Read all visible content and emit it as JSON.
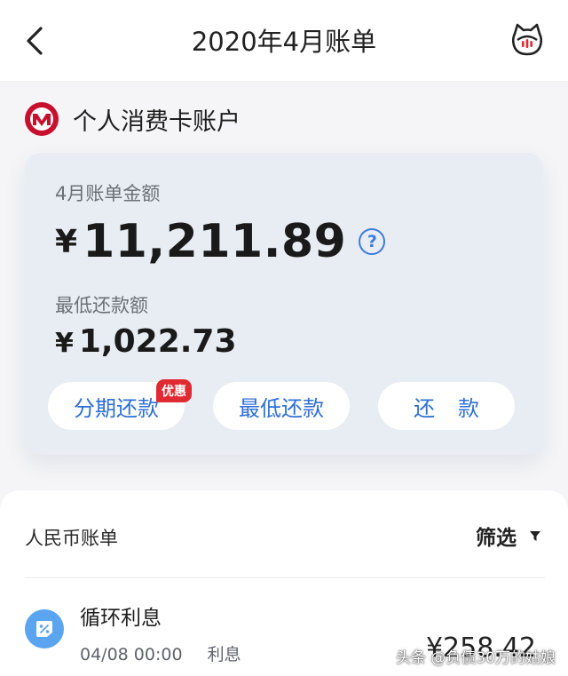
{
  "nav": {
    "title": "2020年4月账单",
    "back_icon": "chevron-left-icon",
    "mascot_icon": "cat-mascot-icon"
  },
  "account": {
    "name": "个人消费卡账户",
    "logo_icon": "bank-logo-icon",
    "brand_color": "#c8102e"
  },
  "bill": {
    "label": "4月账单金额",
    "currency": "¥",
    "amount": "11,211.89",
    "help_icon": "?",
    "min_label": "最低还款额",
    "min_amount": "1,022.73"
  },
  "actions": {
    "installment_label": "分期还款",
    "installment_badge": "优惠",
    "min_pay_label": "最低还款",
    "repay_label": "还款",
    "accent_color": "#2f6fd6",
    "badge_color": "#e02a32"
  },
  "list": {
    "title": "人民币账单",
    "filter_label": "筛选",
    "filter_icon": "triangle-down-icon",
    "items": [
      {
        "title": "循环利息",
        "date": "04/08 00:00",
        "category": "利息",
        "amount": "¥258.42",
        "icon": "percent-tag-icon"
      }
    ]
  },
  "watermark": "头条 @负债30万的姑娘"
}
